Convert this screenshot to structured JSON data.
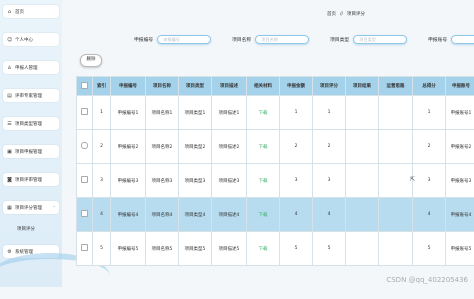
{
  "sidebar": {
    "items": [
      {
        "label": "首页",
        "icon": "home-icon"
      },
      {
        "label": "个人中心",
        "icon": "user-icon"
      },
      {
        "label": "申报人管理",
        "icon": "users-icon"
      },
      {
        "label": "评审专家管理",
        "icon": "expert-icon"
      },
      {
        "label": "项目类型管理",
        "icon": "list-icon"
      },
      {
        "label": "项目申报管理",
        "icon": "folder-icon"
      },
      {
        "label": "项目评审管理",
        "icon": "review-icon"
      },
      {
        "label": "项目评分管理",
        "icon": "score-icon"
      },
      {
        "label": "项目评分",
        "icon": ""
      },
      {
        "label": "系统管理",
        "icon": "gear-icon"
      }
    ]
  },
  "breadcrumb": {
    "home": "首页",
    "sep": "//",
    "current": "项目评分"
  },
  "filters": [
    {
      "label": "申报编号",
      "placeholder": "申报编号"
    },
    {
      "label": "项目名称",
      "placeholder": "项目名称"
    },
    {
      "label": "项目类型",
      "placeholder": "项目类型"
    },
    {
      "label": "申报账号",
      "placeholder": ""
    }
  ],
  "delete_label": "删除",
  "table": {
    "headers": [
      "",
      "索引",
      "申报编号",
      "项目名称",
      "项目类型",
      "项目描述",
      "相关材料",
      "申报金额",
      "项目评分",
      "项目结果",
      "运营思路",
      "总得分",
      "申报账号"
    ],
    "rows": [
      [
        "",
        "1",
        "申报编号1",
        "项目名称1",
        "项目类型1",
        "项目描述1",
        "下载",
        "1",
        "1",
        "",
        "",
        "1",
        "申报账号1"
      ],
      [
        "",
        "2",
        "申报编号2",
        "项目名称2",
        "项目类型2",
        "项目描述2",
        "下载",
        "2",
        "2",
        "",
        "",
        "2",
        "申报账号2"
      ],
      [
        "",
        "3",
        "申报编号3",
        "项目名称3",
        "项目类型3",
        "项目描述3",
        "下载",
        "3",
        "3",
        "",
        "",
        "3",
        "申报账号3"
      ],
      [
        "",
        "4",
        "申报编号4",
        "项目名称4",
        "项目类型4",
        "项目描述4",
        "下载",
        "4",
        "4",
        "",
        "",
        "4",
        "申报账号4"
      ],
      [
        "",
        "5",
        "申报编号5",
        "项目名称5",
        "项目类型5",
        "项目描述5",
        "下载",
        "5",
        "5",
        "",
        "",
        "5",
        "申报账号5"
      ]
    ],
    "highlight_row": 3
  },
  "watermark": "CSDN @qq_402205436"
}
